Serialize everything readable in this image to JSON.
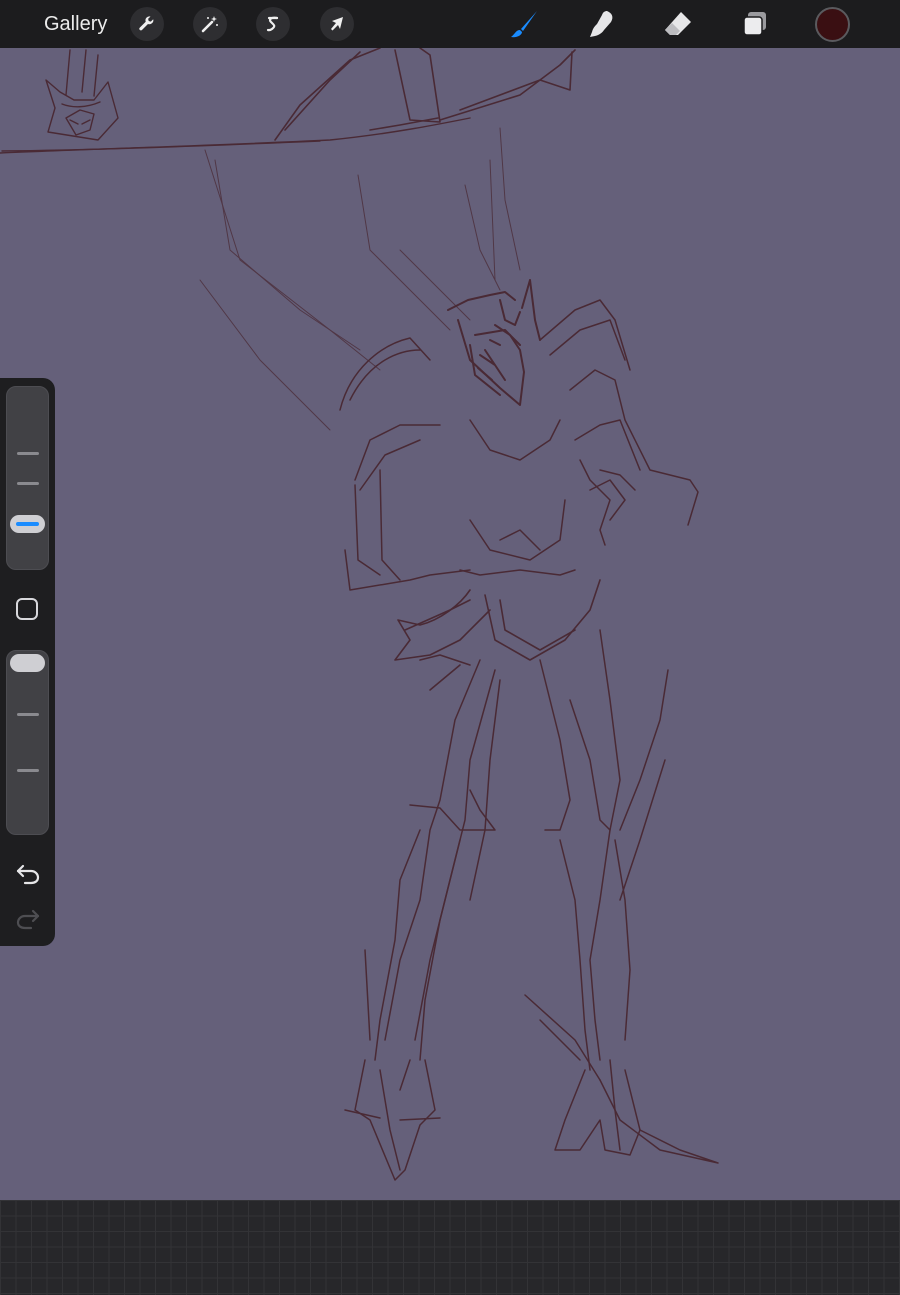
{
  "topbar": {
    "gallery_label": "Gallery",
    "left_tools": [
      {
        "name": "actions",
        "icon": "wrench-icon"
      },
      {
        "name": "adjustments",
        "icon": "magic-wand-icon"
      },
      {
        "name": "selection",
        "icon": "selection-s-icon"
      },
      {
        "name": "transform",
        "icon": "arrow-cursor-icon"
      }
    ],
    "right_tools": [
      {
        "name": "brush",
        "icon": "brush-icon",
        "active": true
      },
      {
        "name": "smudge",
        "icon": "smudge-finger-icon",
        "active": false
      },
      {
        "name": "eraser",
        "icon": "eraser-icon",
        "active": false
      },
      {
        "name": "layers",
        "icon": "layers-icon",
        "active": false
      }
    ],
    "current_color": "#3a0f12"
  },
  "colors": {
    "canvas_background": "#65607a",
    "sketch_stroke": "#4a2a35",
    "accent": "#1a8cff",
    "toolbar_background": "#1c1c1e"
  },
  "sidebar": {
    "brush_size_level": 0.22,
    "opacity_level": 1.0,
    "modifier_icon": "square-icon",
    "undo_icon": "undo-arrow-icon",
    "redo_icon": "redo-arrow-icon",
    "redo_enabled": false
  }
}
